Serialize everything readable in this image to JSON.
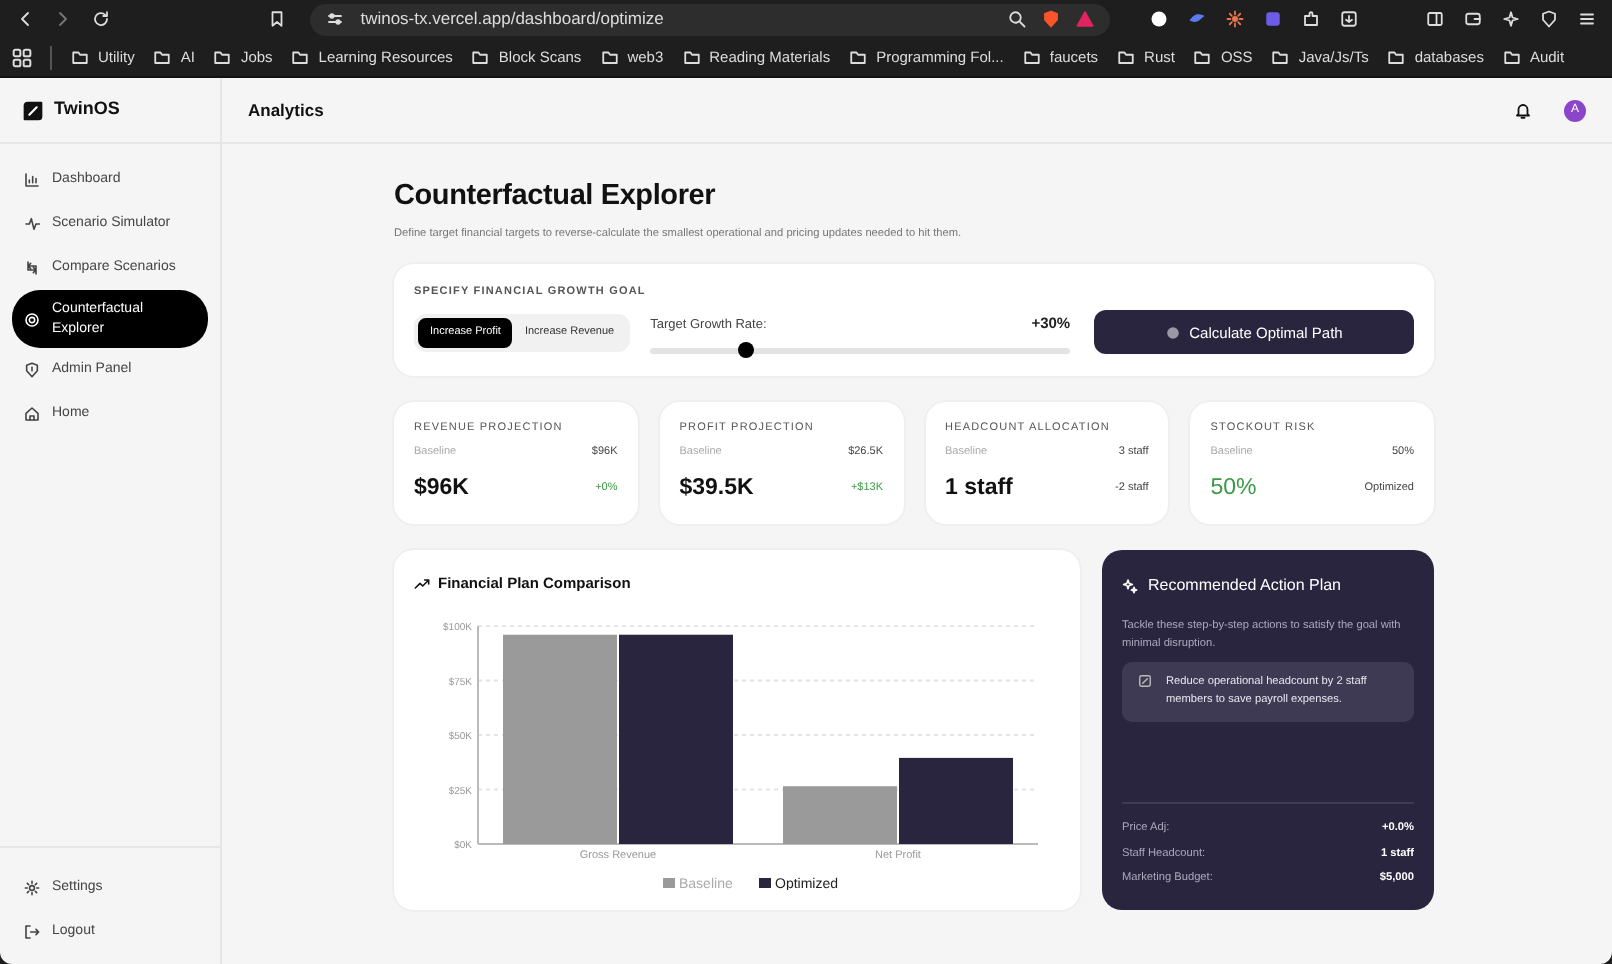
{
  "browser": {
    "url": "twinos-tx.vercel.app/dashboard/optimize",
    "bookmarks": [
      "Utility",
      "AI",
      "Jobs",
      "Learning Resources",
      "Block Scans",
      "web3",
      "Reading Materials",
      "Programming Fol...",
      "faucets",
      "Rust",
      "OSS",
      "Java/Js/Ts",
      "databases",
      "Audit"
    ]
  },
  "sidebar": {
    "brand": "TwinOS",
    "items": [
      {
        "label": "Dashboard",
        "selected": false
      },
      {
        "label": "Scenario Simulator",
        "selected": false
      },
      {
        "label": "Compare Scenarios",
        "selected": false
      },
      {
        "label": "Counterfactual Explorer",
        "selected": true
      },
      {
        "label": "Admin Panel",
        "selected": false
      },
      {
        "label": "Home",
        "selected": false
      }
    ],
    "footer_items": [
      "Settings",
      "Logout"
    ]
  },
  "header": {
    "title": "Analytics",
    "avatar": "A"
  },
  "page": {
    "title": "Counterfactual Explorer",
    "subtitle": "Define target financial targets to reverse-calculate the smallest operational and pricing updates needed to hit them."
  },
  "goal": {
    "heading": "SPECIFY FINANCIAL GROWTH GOAL",
    "modes": [
      {
        "label": "Increase Profit",
        "selected": true
      },
      {
        "label": "Increase Revenue",
        "selected": false
      }
    ],
    "rate_label": "Target Growth Rate:",
    "rate_value": "+30%",
    "level": 0.23,
    "button": "Calculate Optimal Path"
  },
  "kpis": [
    {
      "title": "REVENUE PROJECTION",
      "baseline_label": "Baseline",
      "baseline_value": "$96K",
      "value": "$96K",
      "value_positive": false,
      "delta": "+0%",
      "delta_positive": true
    },
    {
      "title": "PROFIT PROJECTION",
      "baseline_label": "Baseline",
      "baseline_value": "$26.5K",
      "value": "$39.5K",
      "value_positive": false,
      "delta": "+$13K",
      "delta_positive": true
    },
    {
      "title": "HEADCOUNT ALLOCATION",
      "baseline_label": "Baseline",
      "baseline_value": "3 staff",
      "value": "1 staff",
      "value_positive": false,
      "delta": "-2 staff",
      "delta_positive": false
    },
    {
      "title": "STOCKOUT RISK",
      "baseline_label": "Baseline",
      "baseline_value": "50%",
      "value": "50%",
      "value_positive": true,
      "delta": "Optimized",
      "delta_positive": false
    }
  ],
  "chart": {
    "title": "Financial Plan Comparison",
    "chart_data": {
      "type": "bar",
      "categories": [
        "Gross Revenue",
        "Net Profit"
      ],
      "series": [
        {
          "name": "Baseline",
          "color": "#9a9a9a",
          "values": [
            96000,
            26500
          ]
        },
        {
          "name": "Optimized",
          "color": "#29253f",
          "values": [
            96000,
            39500
          ]
        }
      ],
      "ylim": [
        0,
        100000
      ],
      "grid": true,
      "legend": true,
      "yticks": [
        {
          "value": 0,
          "label": "$0K"
        },
        {
          "value": 25000,
          "label": "$25K"
        },
        {
          "value": 50000,
          "label": "$50K"
        },
        {
          "value": 75000,
          "label": "$75K"
        },
        {
          "value": 100000,
          "label": "$100K"
        }
      ]
    }
  },
  "plan": {
    "title": "Recommended Action Plan",
    "intro": "Tackle these step-by-step actions to satisfy the goal with minimal disruption.",
    "actions": [
      "Reduce operational headcount by 2 staff members to save payroll expenses."
    ],
    "summary": [
      {
        "label": "Price Adj:",
        "value": "+0.0%"
      },
      {
        "label": "Staff Headcount:",
        "value": "1 staff"
      },
      {
        "label": "Marketing Budget:",
        "value": "$5,000"
      }
    ]
  }
}
